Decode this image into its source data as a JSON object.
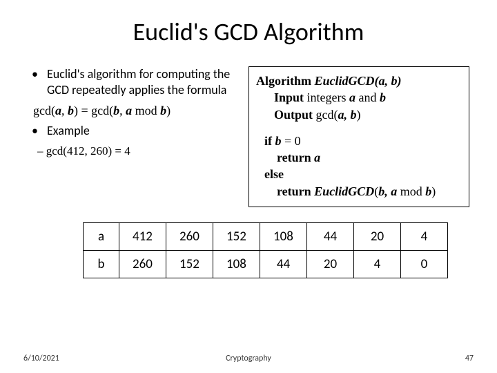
{
  "title": "Euclid's GCD Algorithm",
  "bullets": {
    "b1": "Euclid's algorithm for computing the GCD repeatedly applies the formula",
    "formula_plain": "gcd(a, b) = gcd(b, a mod b)",
    "b2": "Example",
    "sub": "– gcd(412, 260) = 4"
  },
  "algo": {
    "kw_algo": "Algorithm",
    "name": "EuclidGCD",
    "args": "(a, b)",
    "kw_input": "Input",
    "input_text": "integers ",
    "input_a": "a",
    "input_and": " and ",
    "input_b": "b",
    "kw_output": "Output",
    "output_text": " gcd(",
    "output_ab": "a, b",
    "output_close": ")",
    "kw_if": "if ",
    "cond_var": "b",
    "cond_rest": " = 0",
    "kw_return1": "return ",
    "ret1": "a",
    "kw_else": "else",
    "kw_return2": "return ",
    "ret2_name": "EuclidGCD",
    "ret2_open": "(",
    "ret2_args": "b, a ",
    "ret2_mod": "mod ",
    "ret2_b": "b",
    "ret2_close": ")"
  },
  "table": {
    "row_a_label": "a",
    "row_b_label": "b",
    "a": [
      "412",
      "260",
      "152",
      "108",
      "44",
      "20",
      "4"
    ],
    "b": [
      "260",
      "152",
      "108",
      "44",
      "20",
      "4",
      "0"
    ]
  },
  "footer": {
    "date": "6/10/2021",
    "center": "Cryptography",
    "page": "47"
  }
}
